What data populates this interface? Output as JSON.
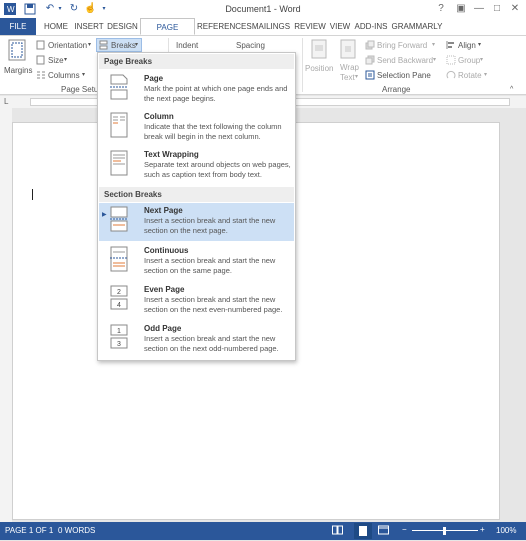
{
  "window": {
    "title": "Document1 - Word",
    "help": "?",
    "minimize": "—",
    "maximize": "□",
    "close": "✕"
  },
  "quick_access": {
    "save_icon": "save-icon",
    "undo_icon": "undo-icon",
    "redo_icon": "redo-icon",
    "touch_icon": "touch-mode-icon",
    "customize_icon": "customize-qat-icon"
  },
  "tabs": [
    "FILE",
    "HOME",
    "INSERT",
    "DESIGN",
    "PAGE LAYOUT",
    "REFERENCES",
    "MAILINGS",
    "REVIEW",
    "VIEW",
    "ADD-INS",
    "GRAMMARLY"
  ],
  "active_tab": "PAGE LAYOUT",
  "ribbon": {
    "margins": "Margins",
    "orientation": "Orientation",
    "size": "Size",
    "columns": "Columns",
    "breaks": "Breaks",
    "group_page_setup": "Page Setu",
    "indent": "Indent",
    "spacing": "Spacing",
    "position": "Position",
    "wrap_text_1": "Wrap",
    "wrap_text_2": "Text",
    "bring_forward": "Bring Forward",
    "send_backward": "Send Backward",
    "selection_pane": "Selection Pane",
    "align": "Align",
    "group": "Group",
    "rotate": "Rotate",
    "group_arrange": "Arrange"
  },
  "breaks_menu": {
    "page_breaks_header": "Page Breaks",
    "section_breaks_header": "Section Breaks",
    "items": [
      {
        "title": "Page",
        "desc": "Mark the point at which one page ends and the next page begins."
      },
      {
        "title": "Column",
        "desc": "Indicate that the text following the column break will begin in the next column."
      },
      {
        "title": "Text Wrapping",
        "desc": "Separate text around objects on web pages, such as caption text from body text."
      },
      {
        "title": "Next Page",
        "desc": "Insert a section break and start the new section on the next page."
      },
      {
        "title": "Continuous",
        "desc": "Insert a section break and start the new section on the same page."
      },
      {
        "title": "Even Page",
        "desc": "Insert a section break and start the new section on the next even-numbered page."
      },
      {
        "title": "Odd Page",
        "desc": "Insert a section break and start the new section on the next odd-numbered page."
      }
    ],
    "selected": "Next Page"
  },
  "status": {
    "page": "PAGE 1 OF 1",
    "words": "0 WORDS",
    "zoom": "100%",
    "zoom_minus": "−",
    "zoom_plus": "+"
  },
  "colors": {
    "accent": "#2b579a",
    "highlight": "#cde0f5"
  }
}
